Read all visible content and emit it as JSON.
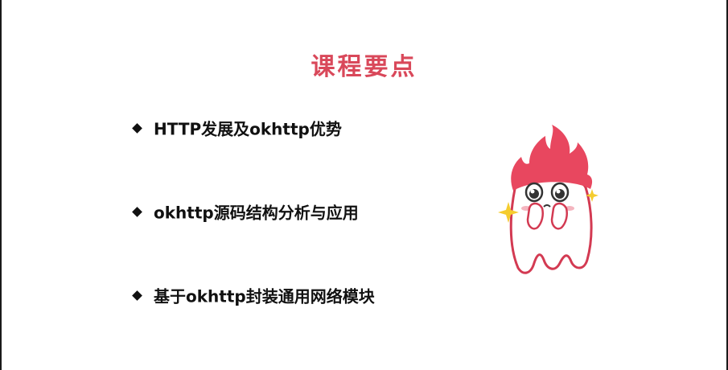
{
  "slide": {
    "title": "课程要点",
    "bullets": [
      "HTTP发展及okhttp优势",
      "okhttp源码结构分析与应用",
      "基于okhttp封装通用网络模块"
    ]
  },
  "colors": {
    "title": "#d9485a",
    "text": "#111111",
    "mascot_flame": "#e8475f",
    "mascot_outline": "#d33a52",
    "sparkle": "#f5cc2e"
  },
  "icons": {
    "mascot": "flame-head-mascot-illustration",
    "bullet": "diamond-bullet-icon"
  }
}
